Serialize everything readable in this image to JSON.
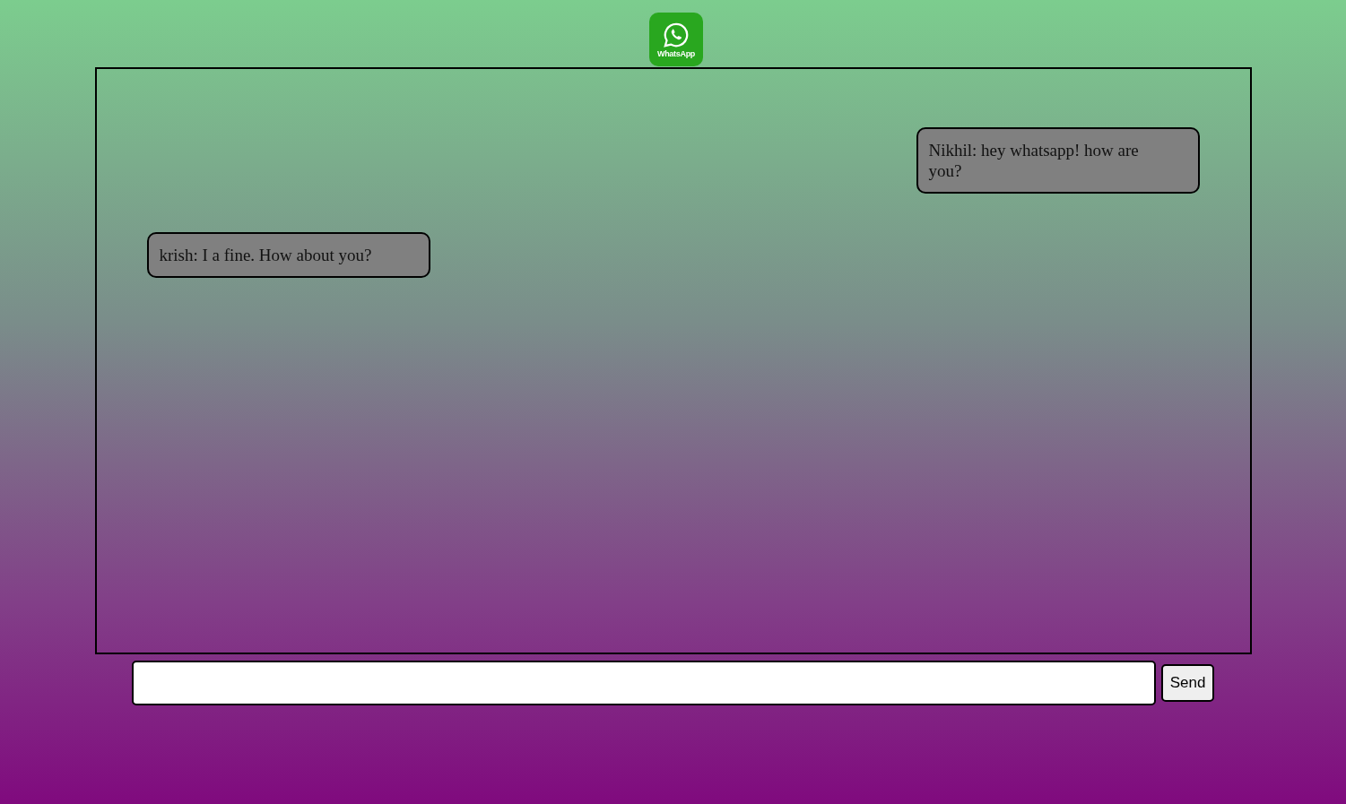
{
  "logo": {
    "label": "WhatsApp"
  },
  "messages": [
    {
      "kind": "outgoing",
      "text": "Nikhil: hey whatsapp! how are you?"
    },
    {
      "kind": "incoming",
      "text": "krish: I a fine. How about you?"
    }
  ],
  "composer": {
    "button": "Send"
  }
}
